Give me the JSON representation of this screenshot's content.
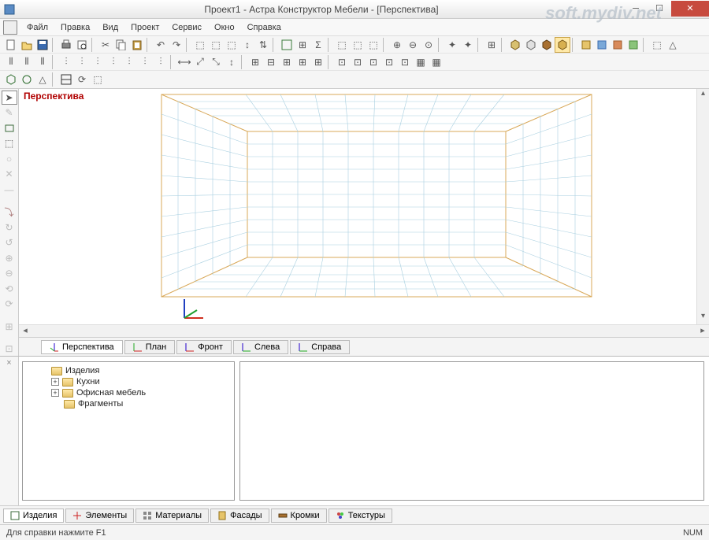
{
  "window": {
    "title": "Проект1 - Астра Конструктор Мебели - [Перспектива]"
  },
  "menu": {
    "items": [
      "Файл",
      "Правка",
      "Вид",
      "Проект",
      "Сервис",
      "Окно",
      "Справка"
    ]
  },
  "viewport": {
    "label": "Перспектива"
  },
  "viewtabs": {
    "items": [
      "Перспектива",
      "План",
      "Фронт",
      "Слева",
      "Справа"
    ],
    "active": 0
  },
  "tree": {
    "root": "Изделия",
    "children": [
      {
        "label": "Кухни",
        "expandable": true
      },
      {
        "label": "Офисная мебель",
        "expandable": true
      },
      {
        "label": "Фрагменты",
        "expandable": false
      }
    ]
  },
  "bottomtabs": {
    "items": [
      "Изделия",
      "Элементы",
      "Материалы",
      "Фасады",
      "Кромки",
      "Текстуры"
    ],
    "active": 0
  },
  "statusbar": {
    "hint": "Для справки нажмите F1",
    "num": "NUM"
  },
  "watermark": "soft.mydiv.net"
}
